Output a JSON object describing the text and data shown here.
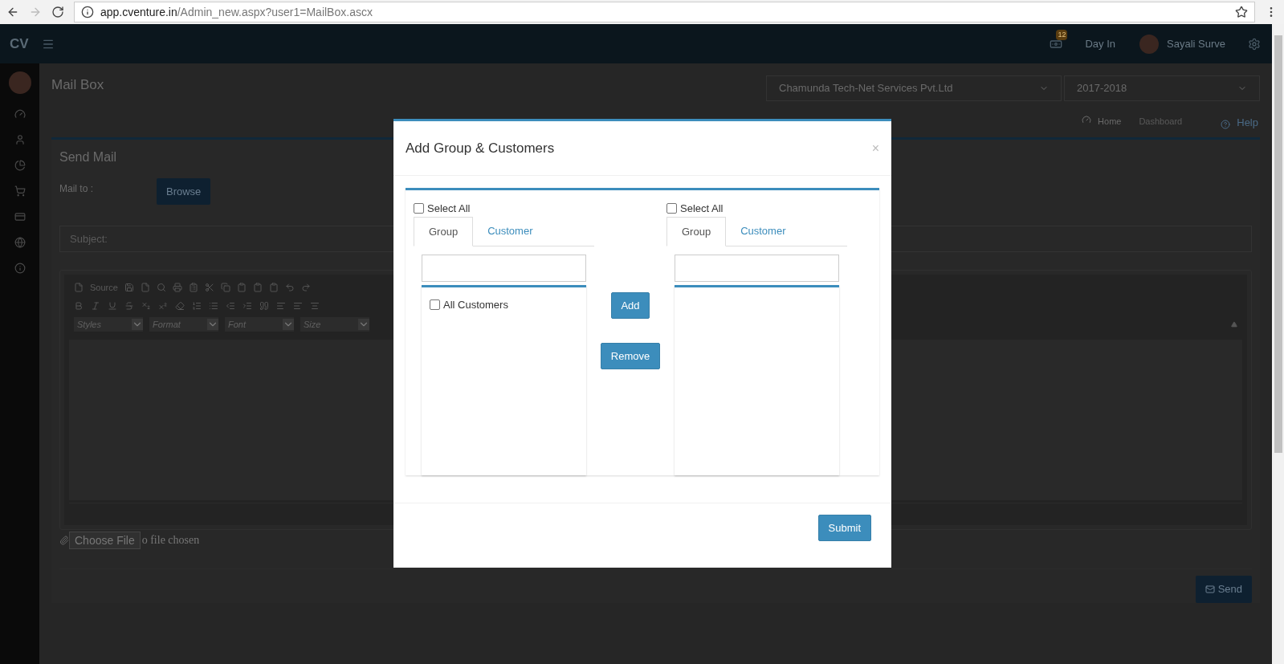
{
  "browser": {
    "url_host": "app.cventure.in",
    "url_path": "/Admin_new.aspx?user1=MailBox.ascx"
  },
  "header": {
    "logo": "CV",
    "notification_count": "12",
    "day_in": "Day In",
    "user_name": "Sayali Surve"
  },
  "page": {
    "title": "Mail Box",
    "company_select": "Chamunda Tech-Net Services Pvt.Ltd",
    "year_select": "2017-2018",
    "breadcrumb": [
      "Home",
      "Dashboard"
    ],
    "help": "Help"
  },
  "send_mail": {
    "title": "Send Mail",
    "mail_to_label": "Mail to :",
    "browse_button": "Browse",
    "subject_placeholder": "Subject:",
    "source_label": "Source",
    "combos": [
      "Styles",
      "Format",
      "Font",
      "Size"
    ],
    "choose_file_button": "Choose File",
    "file_status": "o file chosen",
    "send_button": "Send"
  },
  "modal": {
    "title": "Add Group & Customers",
    "close": "×",
    "panels": [
      {
        "select_all": {
          "label": "Select All",
          "checked": false
        },
        "tabs": [
          {
            "label": "Group",
            "selected": true
          },
          {
            "label": "Customer",
            "selected": false
          }
        ],
        "items": [
          {
            "label": "All Customers",
            "checked": false
          }
        ]
      },
      {
        "select_all": {
          "label": "Select All",
          "checked": false
        },
        "tabs": [
          {
            "label": "Group",
            "selected": true
          },
          {
            "label": "Customer",
            "selected": false
          }
        ]
      }
    ],
    "add_button": "Add",
    "remove_button": "Remove",
    "submit_button": "Submit"
  }
}
